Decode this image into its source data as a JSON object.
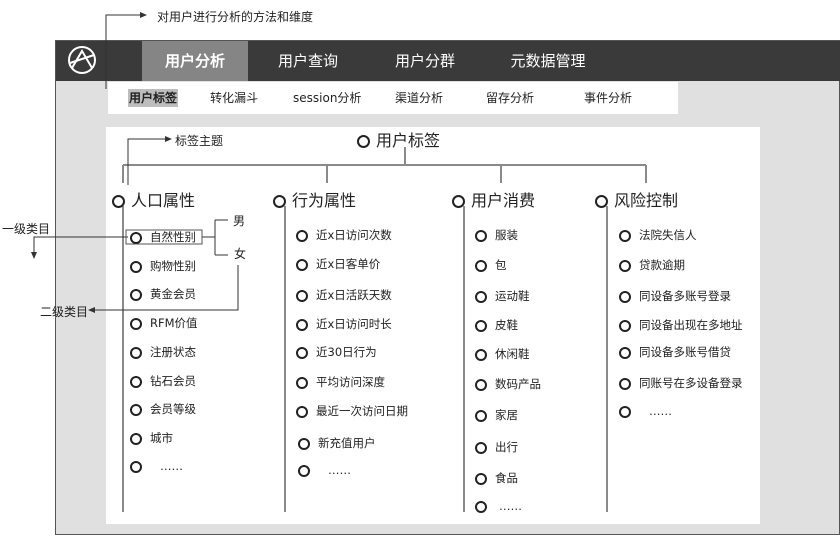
{
  "annotations": {
    "methods": "对用户进行分析的方法和维度",
    "tag_theme": "标签主题",
    "level1": "一级类目",
    "level2": "二级类目"
  },
  "nav": {
    "tabs": [
      "用户分析",
      "用户查询",
      "用户分群",
      "元数据管理"
    ],
    "active": "用户分析"
  },
  "subnav": {
    "tabs": [
      "用户标签",
      "转化漏斗",
      "session分析",
      "渠道分析",
      "留存分析",
      "事件分析"
    ],
    "active": "用户标签"
  },
  "tree": {
    "root": "用户标签",
    "categories": [
      {
        "name": "人口属性",
        "items": [
          "自然性别",
          "购物性别",
          "黄金会员",
          "RFM价值",
          "注册状态",
          "钻石会员",
          "会员等级",
          "城市",
          "……"
        ]
      },
      {
        "name": "行为属性",
        "items": [
          "近x日访问次数",
          "近x日客单价",
          "近x日活跃天数",
          "近x日访问时长",
          "近30日行为",
          "平均访问深度",
          "最近一次访问日期",
          "新充值用户",
          "……"
        ]
      },
      {
        "name": "用户消费",
        "items": [
          "服装",
          "包",
          "运动鞋",
          "皮鞋",
          "休闲鞋",
          "数码产品",
          "家居",
          "出行",
          "食品",
          "……"
        ]
      },
      {
        "name": "风险控制",
        "items": [
          "法院失信人",
          "贷款逾期",
          "同设备多账号登录",
          "同设备出现在多地址",
          "同设备多账号借贷",
          "同账号在多设备登录",
          "……"
        ]
      }
    ],
    "gender_values": [
      "男",
      "女"
    ]
  }
}
